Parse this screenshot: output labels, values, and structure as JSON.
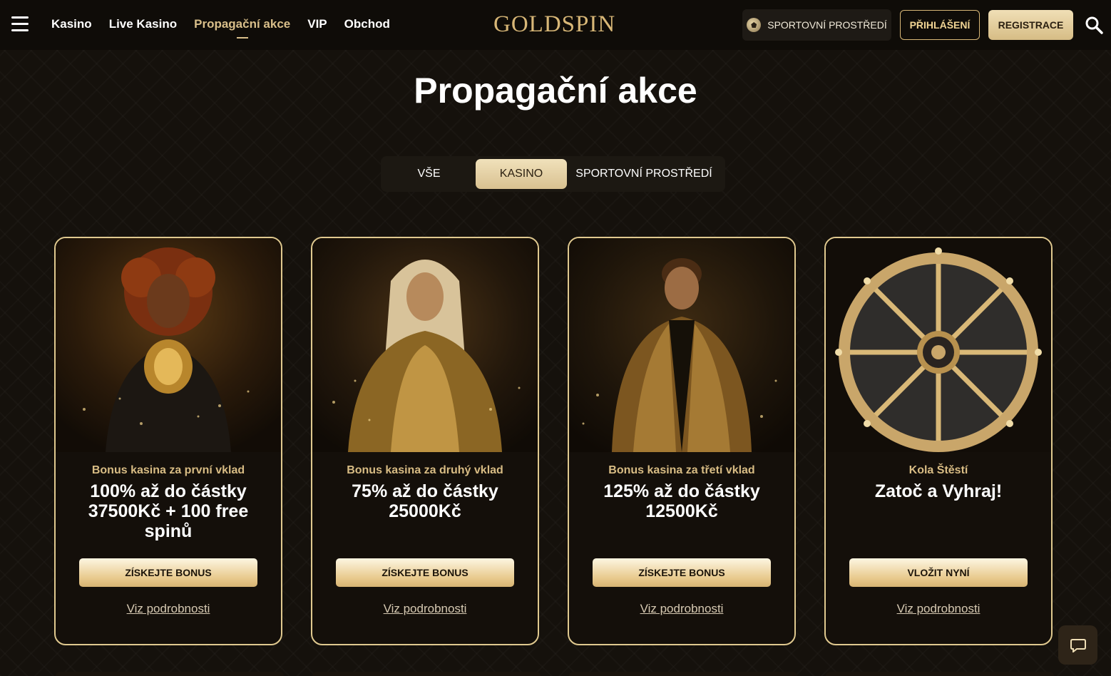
{
  "header": {
    "nav": [
      "Kasino",
      "Live Kasino",
      "Propagační akce",
      "VIP",
      "Obchod"
    ],
    "active_nav": "Propagační akce",
    "logo": "GOLDSPIN",
    "sport_button": "SPORTOVNÍ PROSTŘEDÍ",
    "login": "PŘIHLÁŠENÍ",
    "register": "REGISTRACE"
  },
  "page": {
    "title": "Propagační akce"
  },
  "tabs": [
    {
      "label": "VŠE",
      "active": false
    },
    {
      "label": "KASINO",
      "active": true
    },
    {
      "label": "SPORTOVNÍ PROSTŘEDÍ",
      "active": false
    }
  ],
  "cards": [
    {
      "subtitle": "Bonus kasina za první vklad",
      "headline": "100% až do částky 37500Kč + 100 free spinů",
      "button": "ZÍSKEJTE BONUS",
      "link": "Viz podrobnosti"
    },
    {
      "subtitle": "Bonus kasina za druhý vklad",
      "headline": "75% až do částky 25000Kč",
      "button": "ZÍSKEJTE BONUS",
      "link": "Viz podrobnosti"
    },
    {
      "subtitle": "Bonus kasina za třetí vklad",
      "headline": "125% až do částky 12500Kč",
      "button": "ZÍSKEJTE BONUS",
      "link": "Viz podrobnosti"
    },
    {
      "subtitle": "Kola Štěstí",
      "headline": "Zatoč a Vyhraj!",
      "button": "VLOŽIT NYNÍ",
      "link": "Viz podrobnosti"
    }
  ],
  "colors": {
    "gold": "#d8b777",
    "background": "#15110c",
    "card_border": "#e0c98f"
  },
  "icons": [
    "menu-icon",
    "soccer-ball-icon",
    "search-icon",
    "chat-icon"
  ]
}
